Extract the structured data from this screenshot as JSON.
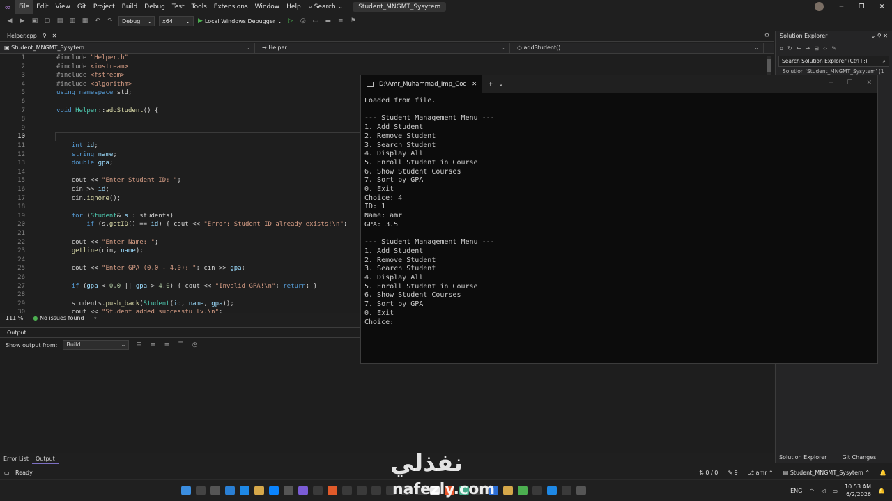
{
  "menu": {
    "items": [
      "File",
      "Edit",
      "View",
      "Git",
      "Project",
      "Build",
      "Debug",
      "Test",
      "Tools",
      "Extensions",
      "Window",
      "Help"
    ],
    "search_label": "Search",
    "project_title": "Student_MNGMT_Sysytem"
  },
  "toolbar": {
    "config": "Debug",
    "platform": "x64",
    "run_label": "Local Windows Debugger"
  },
  "editor": {
    "tab_label": "Helper.cpp",
    "nav_project": "Student_MNGMT_Sysytem",
    "nav_class": "Helper",
    "nav_member": "addStudent()",
    "zoom": "111 %",
    "issues": "No issues found"
  },
  "code_lines": [
    {
      "n": "1",
      "html": "<span class='pp'>#include</span> <span class='str'>\"Helper.h\"</span>"
    },
    {
      "n": "2",
      "html": "<span class='pp'>#include</span> <span class='str'>&lt;iostream&gt;</span>"
    },
    {
      "n": "3",
      "html": "<span class='pp'>#include</span> <span class='str'>&lt;fstream&gt;</span>"
    },
    {
      "n": "4",
      "html": "<span class='pp'>#include</span> <span class='str'>&lt;algorithm&gt;</span>"
    },
    {
      "n": "5",
      "html": "<span class='kw'>using namespace</span> std;"
    },
    {
      "n": "6",
      "html": ""
    },
    {
      "n": "7",
      "html": "<span class='kw'>void</span> <span class='ty'>Helper</span>::<span class='fn'>addStudent</span>() {"
    },
    {
      "n": "8",
      "html": ""
    },
    {
      "n": "9",
      "html": ""
    },
    {
      "n": "10",
      "html": ""
    },
    {
      "n": "11",
      "html": "    <span class='kw'>int</span> <span class='var'>id</span>;"
    },
    {
      "n": "12",
      "html": "    <span class='kw'>string</span> <span class='var'>name</span>;"
    },
    {
      "n": "13",
      "html": "    <span class='kw'>double</span> <span class='var'>gpa</span>;"
    },
    {
      "n": "14",
      "html": ""
    },
    {
      "n": "15",
      "html": "    cout &lt;&lt; <span class='str'>\"Enter Student ID: \"</span>;"
    },
    {
      "n": "16",
      "html": "    cin &gt;&gt; <span class='var'>id</span>;"
    },
    {
      "n": "17",
      "html": "    cin.<span class='fn'>ignore</span>();"
    },
    {
      "n": "18",
      "html": ""
    },
    {
      "n": "19",
      "html": "    <span class='kw'>for</span> (<span class='ty'>Student</span>&amp; <span class='var'>s</span> : students)"
    },
    {
      "n": "20",
      "html": "        <span class='kw'>if</span> (s.<span class='fn'>getID</span>() == <span class='var'>id</span>) { cout &lt;&lt; <span class='str'>\"Error: Student ID already exists!\\n\"</span>;"
    },
    {
      "n": "21",
      "html": ""
    },
    {
      "n": "22",
      "html": "    cout &lt;&lt; <span class='str'>\"Enter Name: \"</span>;"
    },
    {
      "n": "23",
      "html": "    <span class='fn'>getline</span>(cin, <span class='var'>name</span>);"
    },
    {
      "n": "24",
      "html": ""
    },
    {
      "n": "25",
      "html": "    cout &lt;&lt; <span class='str'>\"Enter GPA (0.0 - 4.0): \"</span>; cin &gt;&gt; <span class='var'>gpa</span>;"
    },
    {
      "n": "26",
      "html": ""
    },
    {
      "n": "27",
      "html": "    <span class='kw'>if</span> (<span class='var'>gpa</span> &lt; <span class='num'>0.0</span> || <span class='var'>gpa</span> &gt; <span class='num'>4.0</span>) { cout &lt;&lt; <span class='str'>\"Invalid GPA!\\n\"</span>; <span class='kw'>return</span>; }"
    },
    {
      "n": "28",
      "html": ""
    },
    {
      "n": "29",
      "html": "    students.<span class='fn'>push_back</span>(<span class='ty'>Student</span>(<span class='var'>id</span>, <span class='var'>name</span>, <span class='var'>gpa</span>));"
    },
    {
      "n": "30",
      "html": "    cout &lt;&lt; <span class='str'>\"Student added successfully.\\n\"</span>;"
    }
  ],
  "output": {
    "title": "Output",
    "show_from_label": "Show output from:",
    "source": "Build"
  },
  "bottom_tabs": [
    "Error List",
    "Output"
  ],
  "solution_explorer": {
    "title": "Solution Explorer",
    "search_placeholder": "Search Solution Explorer (Ctrl+;)",
    "item": "Solution 'Student_MNGMT_Sysytem' (1",
    "tabs": [
      "Solution Explorer",
      "Git Changes"
    ]
  },
  "terminal": {
    "tab_title": "D:\\Amr_Muhammad_Imp_Coc",
    "content": "Loaded from file.\n\n--- Student Management Menu ---\n1. Add Student\n2. Remove Student\n3. Search Student\n4. Display All\n5. Enroll Student in Course\n6. Show Student Courses\n7. Sort by GPA\n0. Exit\nChoice: 4\nID: 1\nName: amr\nGPA: 3.5\n\n--- Student Management Menu ---\n1. Add Student\n2. Remove Student\n3. Search Student\n4. Display All\n5. Enroll Student in Course\n6. Show Student Courses\n7. Sort by GPA\n0. Exit\nChoice:"
  },
  "status": {
    "ready": "Ready",
    "changes": "0 / 0",
    "commits": "9",
    "user": "amr",
    "repo": "Student_MNGMT_Sysytem"
  },
  "taskbar": {
    "lang": "ENG",
    "time": "10:53 AM",
    "date": "6/2/2026"
  },
  "watermark": {
    "arabic": "نفذلي",
    "latin": "nafezly.com"
  }
}
